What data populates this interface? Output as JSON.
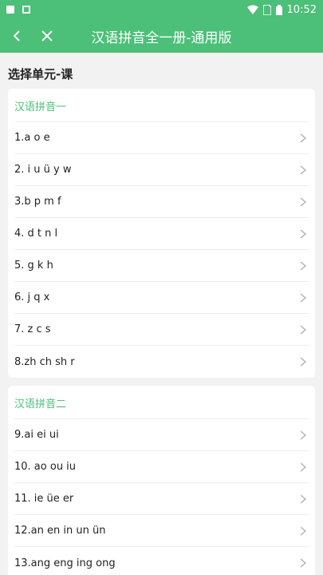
{
  "status_bar": {
    "time": "10:52"
  },
  "app_bar": {
    "title": "汉语拼音全一册-通用版",
    "back_icon": "chevron-left-icon",
    "close_icon": "close-icon"
  },
  "page": {
    "heading": "选择单元-课"
  },
  "units": [
    {
      "title": "汉语拼音一",
      "lessons": [
        "1.a o e",
        "2. i u ü y w",
        "3.b p m f",
        "4. d t n l",
        "5. g k h",
        "6. j q x",
        "7. z c s",
        "8.zh ch sh r"
      ]
    },
    {
      "title": "汉语拼音二",
      "lessons": [
        "9.ai ei ui",
        "10. ao ou iu",
        "11. ie üe er",
        "12.an en in un ün",
        "13.ang eng ing ong"
      ]
    }
  ],
  "colors": {
    "accent": "#4cbf78"
  }
}
